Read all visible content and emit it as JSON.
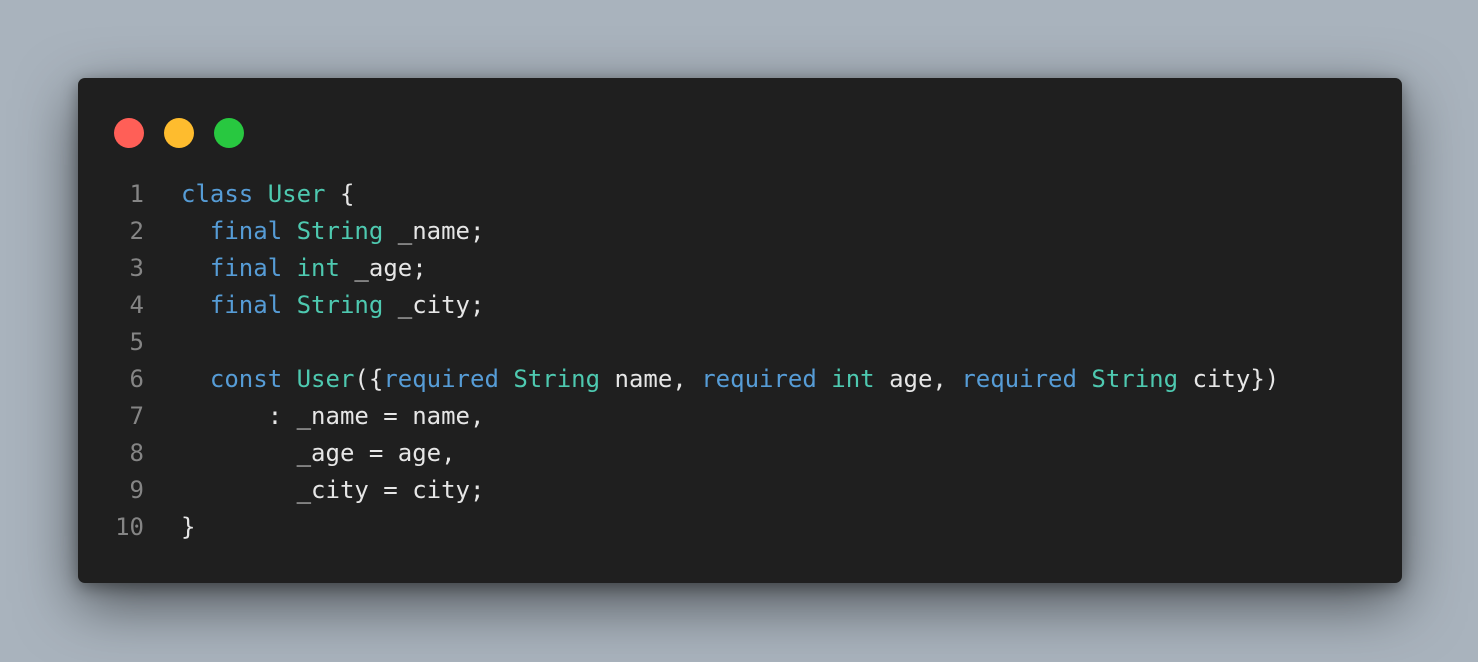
{
  "colors": {
    "background": "#a9b3bd",
    "editor_background": "#1f1f1f",
    "line_number": "#858585",
    "plain": "#e6e6e6",
    "keyword": "#569cd6",
    "type": "#4ec9b0",
    "dot_close": "#ff5f57",
    "dot_minimize": "#febc2e",
    "dot_zoom": "#28c840"
  },
  "window_controls": [
    {
      "name": "close-dot",
      "color": "#ff5f57"
    },
    {
      "name": "minimize-dot",
      "color": "#febc2e"
    },
    {
      "name": "zoom-dot",
      "color": "#28c840"
    }
  ],
  "code": {
    "language": "dart",
    "lines": [
      {
        "number": "1",
        "tokens": [
          {
            "text": "class",
            "kind": "keyword"
          },
          {
            "text": " ",
            "kind": "plain"
          },
          {
            "text": "User",
            "kind": "type"
          },
          {
            "text": " {",
            "kind": "plain"
          }
        ]
      },
      {
        "number": "2",
        "tokens": [
          {
            "text": "  ",
            "kind": "plain"
          },
          {
            "text": "final",
            "kind": "keyword"
          },
          {
            "text": " ",
            "kind": "plain"
          },
          {
            "text": "String",
            "kind": "type"
          },
          {
            "text": " _name;",
            "kind": "plain"
          }
        ]
      },
      {
        "number": "3",
        "tokens": [
          {
            "text": "  ",
            "kind": "plain"
          },
          {
            "text": "final",
            "kind": "keyword"
          },
          {
            "text": " ",
            "kind": "plain"
          },
          {
            "text": "int",
            "kind": "type"
          },
          {
            "text": " _age;",
            "kind": "plain"
          }
        ]
      },
      {
        "number": "4",
        "tokens": [
          {
            "text": "  ",
            "kind": "plain"
          },
          {
            "text": "final",
            "kind": "keyword"
          },
          {
            "text": " ",
            "kind": "plain"
          },
          {
            "text": "String",
            "kind": "type"
          },
          {
            "text": " _city;",
            "kind": "plain"
          }
        ]
      },
      {
        "number": "5",
        "tokens": []
      },
      {
        "number": "6",
        "tokens": [
          {
            "text": "  ",
            "kind": "plain"
          },
          {
            "text": "const",
            "kind": "keyword"
          },
          {
            "text": " ",
            "kind": "plain"
          },
          {
            "text": "User",
            "kind": "type"
          },
          {
            "text": "({",
            "kind": "plain"
          },
          {
            "text": "required",
            "kind": "keyword"
          },
          {
            "text": " ",
            "kind": "plain"
          },
          {
            "text": "String",
            "kind": "type"
          },
          {
            "text": " name, ",
            "kind": "plain"
          },
          {
            "text": "required",
            "kind": "keyword"
          },
          {
            "text": " ",
            "kind": "plain"
          },
          {
            "text": "int",
            "kind": "type"
          },
          {
            "text": " age, ",
            "kind": "plain"
          },
          {
            "text": "required",
            "kind": "keyword"
          },
          {
            "text": " ",
            "kind": "plain"
          },
          {
            "text": "String",
            "kind": "type"
          },
          {
            "text": " city})",
            "kind": "plain"
          }
        ]
      },
      {
        "number": "7",
        "tokens": [
          {
            "text": "      : _name = name,",
            "kind": "plain"
          }
        ]
      },
      {
        "number": "8",
        "tokens": [
          {
            "text": "        _age = age,",
            "kind": "plain"
          }
        ]
      },
      {
        "number": "9",
        "tokens": [
          {
            "text": "        _city = city;",
            "kind": "plain"
          }
        ]
      },
      {
        "number": "10",
        "tokens": [
          {
            "text": "}",
            "kind": "plain"
          }
        ]
      }
    ]
  }
}
